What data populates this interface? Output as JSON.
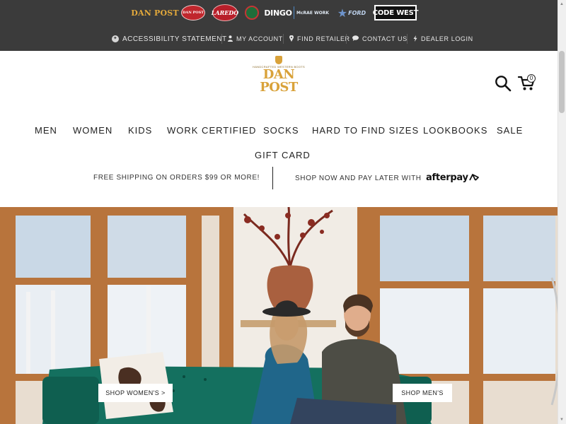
{
  "brands": [
    {
      "name": "DAN POST"
    },
    {
      "name": "DAN POST"
    },
    {
      "name": "LAREDO"
    },
    {
      "name": ""
    },
    {
      "name": "DINGO"
    },
    {
      "name": "McRAE WORK"
    },
    {
      "name": "FORD"
    },
    {
      "name": "CODE WEST"
    }
  ],
  "utility": {
    "accessibility": "ACCESSIBILITY STATEMENT",
    "account": "MY ACCOUNT",
    "retailer": "FIND RETAILER",
    "contact": "CONTACT US",
    "dealer": "DEALER LOGIN"
  },
  "header": {
    "logo_text": "DAN POST",
    "logo_tagline": "HANDCRAFTED WESTERN BOOTS",
    "cart_count": "0"
  },
  "nav": {
    "items": [
      "MEN",
      "WOMEN",
      "KIDS",
      "WORK CERTIFIED",
      "SOCKS",
      "HARD TO FIND SIZES",
      "LOOKBOOKS",
      "SALE",
      "GIFT CARD"
    ]
  },
  "promo": {
    "shipping": "FREE SHIPPING ON ORDERS $99 OR MORE!",
    "pay_later": "SHOP NOW AND PAY LATER WITH",
    "afterpay": "afterpay"
  },
  "hero": {
    "shop_women": "SHOP WOMEN'S >",
    "shop_men": "SHOP MEN'S"
  },
  "colors": {
    "topbar": "#3b3b3b",
    "brand_gold": "#d9a23a",
    "sofa_green": "#14705f"
  },
  "icons": {
    "accessibility": "accessibility-icon",
    "account": "user-icon",
    "retailer": "map-pin-icon",
    "contact": "chat-bubble-icon",
    "dealer": "lightning-icon",
    "search": "search-icon",
    "cart": "shopping-cart-icon"
  }
}
